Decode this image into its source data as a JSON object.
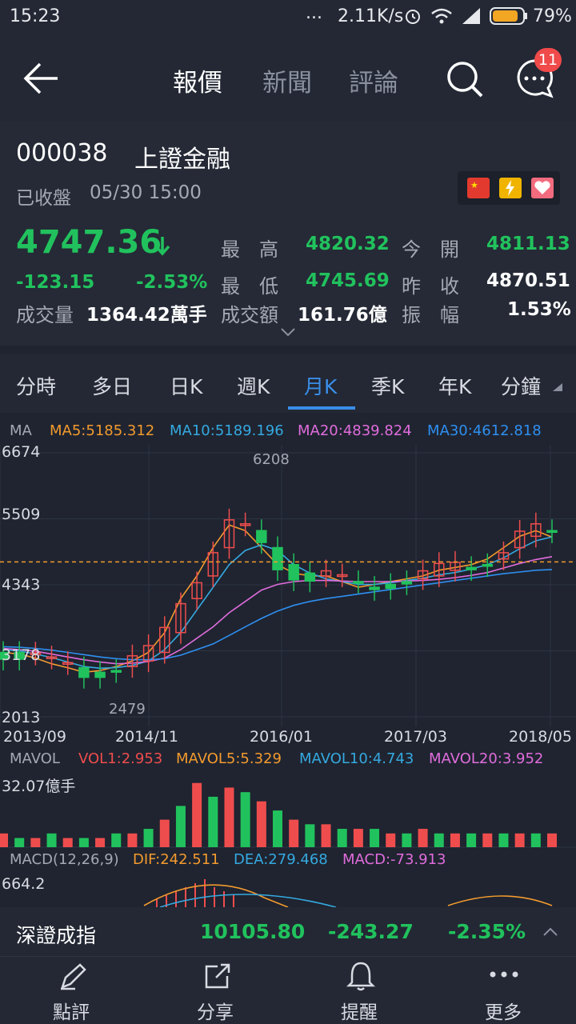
{
  "status_bar": {
    "time": "15:23",
    "dots": "...",
    "speed": "2.11K/s",
    "battery": "79%"
  },
  "nav": {
    "tabs": [
      "報價",
      "新聞",
      "評論"
    ],
    "active_tab": 0,
    "badge": "11"
  },
  "stock": {
    "code": "000038",
    "name": "上證金融",
    "state": "已收盤",
    "datetime": "05/30 15:00",
    "price": "4747.36",
    "change": "-123.15",
    "change_pct": "-2.53%",
    "volume_label": "成交量",
    "volume": "1364.42萬手",
    "stats": [
      {
        "label": "最　高",
        "value": "4820.32",
        "color": "#21c25d"
      },
      {
        "label": "今　開",
        "value": "4811.13",
        "color": "#21c25d"
      },
      {
        "label": "最　低",
        "value": "4745.69",
        "color": "#21c25d"
      },
      {
        "label": "昨　收",
        "value": "4870.51",
        "color": "#ffffff"
      },
      {
        "label": "成交額",
        "value": "161.76億",
        "color": "#ffffff"
      },
      {
        "label": "振　幅",
        "value": "1.53%",
        "color": "#ffffff"
      }
    ]
  },
  "periods": [
    "分時",
    "多日",
    "日K",
    "週K",
    "月K",
    "季K",
    "年K",
    "分鐘"
  ],
  "active_period": 4,
  "ma_legend": {
    "label": "MA",
    "items": [
      {
        "text": "MA5:5185.312",
        "color": "#f39a2e"
      },
      {
        "text": "MA10:5189.196",
        "color": "#35a9e0"
      },
      {
        "text": "MA20:4839.824",
        "color": "#e06cdc"
      },
      {
        "text": "MA30:4612.818",
        "color": "#2f8ff0"
      }
    ]
  },
  "chart_data": {
    "type": "candlestick",
    "y_ticks": [
      "6674",
      "5509",
      "4343",
      "3178",
      "2013"
    ],
    "ylim": [
      2013,
      6674
    ],
    "x_ticks": [
      "2013/09",
      "2014/11",
      "2016/01",
      "2017/03",
      "2018/05"
    ],
    "annotations": [
      {
        "text": "6208",
        "value": 6208
      },
      {
        "text": "2479",
        "value": 2479
      }
    ],
    "current_price": 4747.36,
    "series": [
      {
        "name": "MA5",
        "values": [
          3150,
          3120,
          3050,
          2950,
          2880,
          2800,
          2830,
          2900,
          3000,
          3150,
          3500,
          4100,
          4500,
          5000,
          5400,
          5300,
          5000,
          4700,
          4550,
          4500,
          4500,
          4400,
          4300,
          4350,
          4400,
          4450,
          4500,
          4600,
          4650,
          4700,
          4800,
          5000,
          5200,
          5300,
          5185
        ]
      },
      {
        "name": "MA10",
        "values": [
          3200,
          3180,
          3120,
          3060,
          2980,
          2900,
          2870,
          2880,
          2920,
          3000,
          3200,
          3500,
          3900,
          4300,
          4700,
          4950,
          5050,
          4950,
          4700,
          4550,
          4450,
          4400,
          4350,
          4350,
          4380,
          4420,
          4460,
          4520,
          4560,
          4620,
          4700,
          4820,
          4980,
          5120,
          5189
        ]
      },
      {
        "name": "MA20",
        "values": [
          3220,
          3200,
          3170,
          3120,
          3070,
          3020,
          2980,
          2950,
          2960,
          2990,
          3050,
          3200,
          3400,
          3600,
          3850,
          4050,
          4250,
          4350,
          4400,
          4420,
          4420,
          4410,
          4400,
          4400,
          4400,
          4410,
          4420,
          4440,
          4470,
          4510,
          4560,
          4640,
          4720,
          4790,
          4840
        ]
      },
      {
        "name": "MA30",
        "values": [
          3250,
          3240,
          3220,
          3190,
          3150,
          3110,
          3070,
          3040,
          3020,
          3020,
          3040,
          3100,
          3200,
          3300,
          3450,
          3600,
          3750,
          3880,
          3980,
          4050,
          4100,
          4140,
          4180,
          4220,
          4260,
          4300,
          4340,
          4380,
          4420,
          4460,
          4500,
          4540,
          4570,
          4600,
          4613
        ]
      }
    ]
  },
  "mavol_legend": {
    "label": "MAVOL",
    "items": [
      {
        "text": "VOL1:2.953",
        "color": "#ef4d4d"
      },
      {
        "text": "MAVOL5:5.329",
        "color": "#f39a2e"
      },
      {
        "text": "MAVOL10:4.743",
        "color": "#35a9e0"
      },
      {
        "text": "MAVOL20:3.952",
        "color": "#e06cdc"
      }
    ],
    "max_label": "32.07億手"
  },
  "macd_legend": {
    "label": "MACD(12,26,9)",
    "items": [
      {
        "text": "DIF:242.511",
        "color": "#f39a2e"
      },
      {
        "text": "DEA:279.468",
        "color": "#35a9e0"
      },
      {
        "text": "MACD:-73.913",
        "color": "#e06cdc"
      }
    ],
    "max_label": "664.2"
  },
  "index_bar": {
    "name": "深證成指",
    "value": "10105.80",
    "change": "-243.27",
    "pct": "-2.35%"
  },
  "bottom_nav": [
    "點評",
    "分享",
    "提醒",
    "更多"
  ],
  "colors": {
    "up": "#ef4d4d",
    "down": "#21c25d",
    "accent": "#3a8ee8",
    "badge": "#f04a4a"
  }
}
